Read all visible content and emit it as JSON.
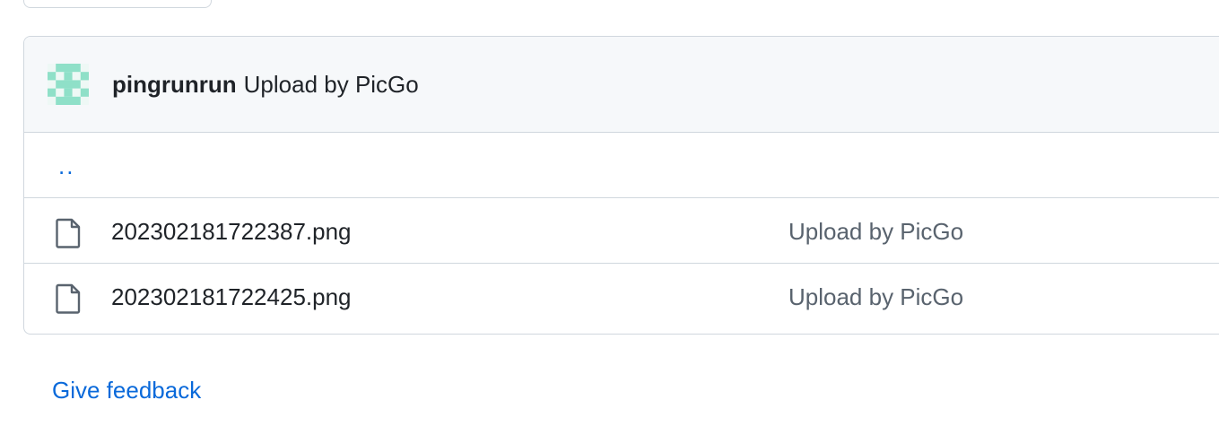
{
  "commit": {
    "author": "pingrunrun",
    "message": "Upload by PicGo"
  },
  "parent_link": "..",
  "files": [
    {
      "name": "202302181722387.png",
      "icon": "file-icon",
      "commit_message": "Upload by PicGo"
    },
    {
      "name": "202302181722425.png",
      "icon": "file-icon",
      "commit_message": "Upload by PicGo"
    }
  ],
  "footer": {
    "feedback_label": "Give feedback"
  },
  "colors": {
    "link": "#0969da",
    "border": "#d0d7de",
    "header_bg": "#f6f8fa",
    "muted_text": "#59636e",
    "avatar": "#8fe0c8"
  }
}
